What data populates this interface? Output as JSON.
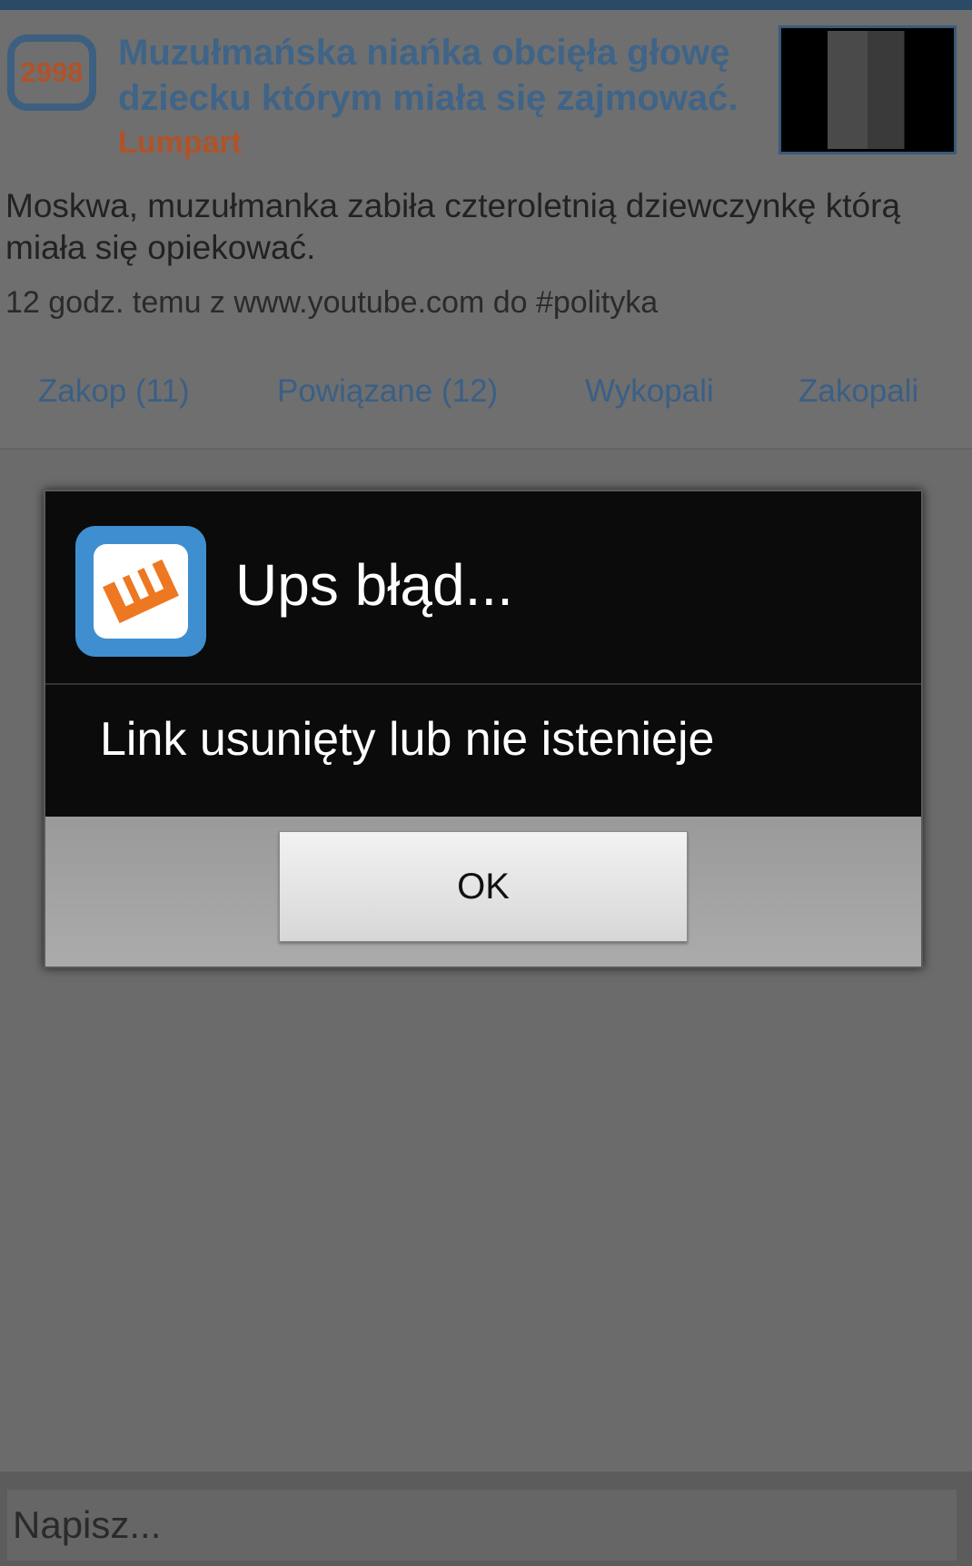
{
  "article": {
    "votes": "2998",
    "title": "Muzułmańska niańka obcięła głowę dziecku którym miała się zajmować.",
    "author": "Lumpart",
    "description": "Moskwa, muzułmanka zabiła czteroletnią dziewczynkę którą miała się opiekować.",
    "meta": "12 godz. temu z www.youtube.com do #polityka"
  },
  "tabs": [
    {
      "label": "Zakop (11)"
    },
    {
      "label": "Powiązane (12)"
    },
    {
      "label": "Wykopali"
    },
    {
      "label": "Zakopali"
    }
  ],
  "dialog": {
    "title": "Ups błąd...",
    "message": "Link usunięty lub nie istenieje",
    "ok_label": "OK"
  },
  "comment": {
    "placeholder": "Napisz..."
  },
  "colors": {
    "title": "#3f6488",
    "author": "#b05328",
    "app_icon_bg": "#3f8fd0",
    "app_icon_mark": "#ee7722"
  }
}
